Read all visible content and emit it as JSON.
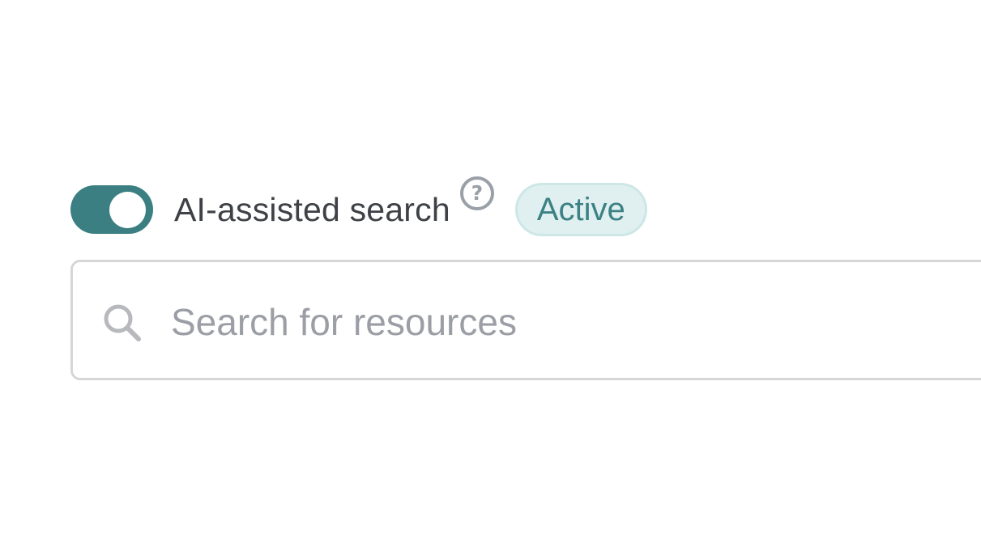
{
  "toggle": {
    "label": "AI-assisted search",
    "state": "on",
    "track_color": "#3c7f82"
  },
  "help": {
    "icon": "question-circle-icon",
    "glyph": "?"
  },
  "badge": {
    "text": "Active",
    "bg_color": "#e0f0f0",
    "text_color": "#3c8184"
  },
  "search": {
    "icon": "search-icon",
    "placeholder": "Search for resources",
    "value": ""
  }
}
